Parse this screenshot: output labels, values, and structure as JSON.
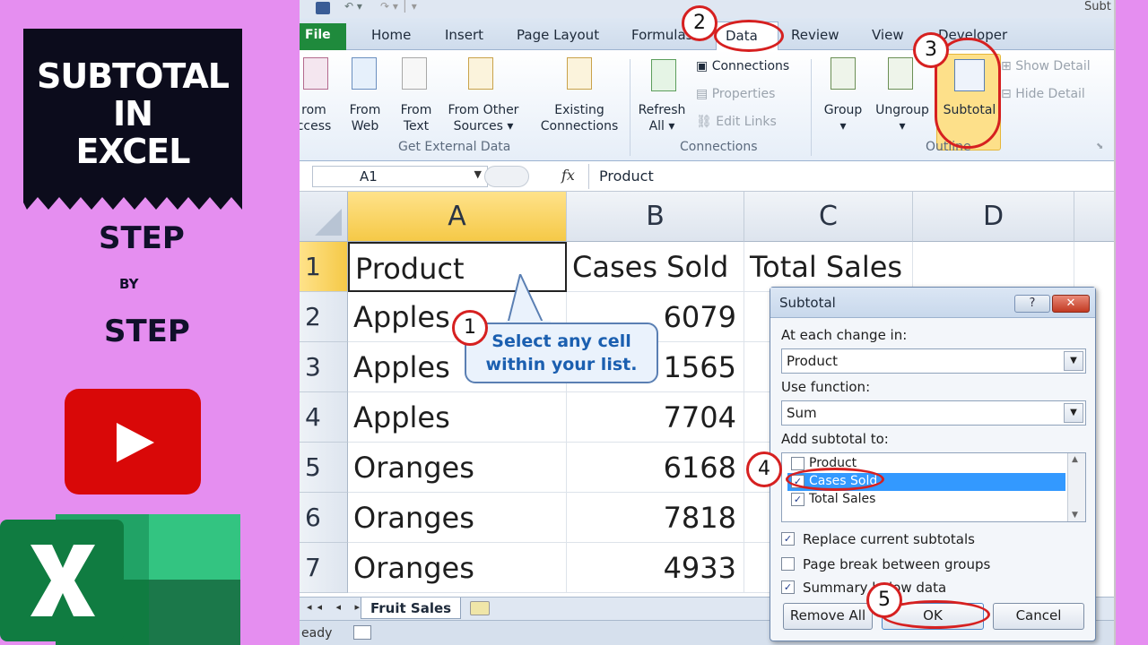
{
  "promo": {
    "title_lines": [
      "SUBTOTAL",
      "IN",
      "EXCEL"
    ],
    "step1": "STEP",
    "by": "BY",
    "step2": "STEP"
  },
  "window": {
    "title_partial": "Subt"
  },
  "tabs": {
    "file": "File",
    "home": "Home",
    "insert": "Insert",
    "page_layout": "Page Layout",
    "formulas": "Formulas",
    "data": "Data",
    "review": "Review",
    "view": "View",
    "developer": "Developer"
  },
  "ribbon": {
    "from_access": [
      "rom",
      "ccess"
    ],
    "from_web": [
      "From",
      "Web"
    ],
    "from_text": [
      "From",
      "Text"
    ],
    "from_other": [
      "From Other",
      "Sources ▾"
    ],
    "existing": [
      "Existing",
      "Connections"
    ],
    "group_external": "Get External Data",
    "refresh": [
      "Refresh",
      "All ▾"
    ],
    "connections": "Connections",
    "properties": "Properties",
    "edit_links": "Edit Links",
    "group_connections": "Connections",
    "group_btn": "Group",
    "ungroup_btn": "Ungroup",
    "subtotal_btn": "Subtotal",
    "show_detail": "Show Detail",
    "hide_detail": "Hide Detail",
    "group_outline": "Outline"
  },
  "formula_bar": {
    "name_box": "A1",
    "fx": "fx",
    "value": "Product"
  },
  "grid": {
    "columns": [
      "A",
      "B",
      "C",
      "D"
    ],
    "rows": [
      {
        "n": "1",
        "a": "Product",
        "b": "Cases Sold",
        "c": "Total Sales"
      },
      {
        "n": "2",
        "a": "Apples",
        "b": "6079",
        "c": ""
      },
      {
        "n": "3",
        "a": "Apples",
        "b": "1565",
        "c": ""
      },
      {
        "n": "4",
        "a": "Apples",
        "b": "7704",
        "c": ""
      },
      {
        "n": "5",
        "a": "Oranges",
        "b": "6168",
        "c": ""
      },
      {
        "n": "6",
        "a": "Oranges",
        "b": "7818",
        "c": ""
      },
      {
        "n": "7",
        "a": "Oranges",
        "b": "4933",
        "c": ""
      }
    ]
  },
  "sheet": {
    "tab": "Fruit Sales",
    "status": "eady"
  },
  "callout": {
    "line1": "Select any cell",
    "line2": "within your list."
  },
  "badges": [
    "1",
    "2",
    "3",
    "4",
    "5"
  ],
  "dialog": {
    "title": "Subtotal",
    "help": "?",
    "close": "✕",
    "at_each_change_label": "At each change in:",
    "at_each_change_value": "Product",
    "use_function_label": "Use function:",
    "use_function_value": "Sum",
    "add_subtotal_label": "Add subtotal to:",
    "list": [
      {
        "label": "Product",
        "checked": false
      },
      {
        "label": "Cases Sold",
        "checked": true
      },
      {
        "label": "Total Sales",
        "checked": true
      }
    ],
    "replace_current": "Replace current subtotals",
    "page_break": "Page break between groups",
    "summary_below": "Summary below data",
    "remove_all": "Remove All",
    "ok": "OK",
    "cancel": "Cancel"
  },
  "colors": {
    "accent_red": "#d62020",
    "excel_green": "#1f8a3c",
    "highlight_blue": "#3399ff",
    "background_pink": "#e58ef0"
  }
}
